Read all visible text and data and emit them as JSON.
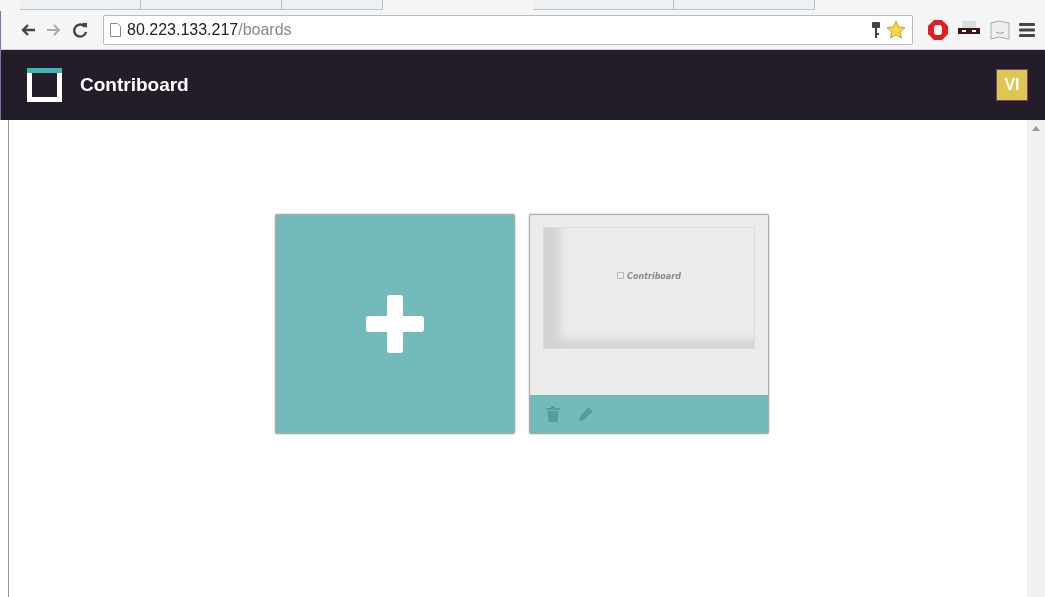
{
  "browser": {
    "url_host": "80.223.133.217",
    "url_path": "/boards"
  },
  "header": {
    "title": "Contriboard",
    "avatar": "VI"
  },
  "boards": [
    {
      "kind": "new"
    },
    {
      "kind": "board",
      "preview_title": "Contriboard"
    }
  ]
}
